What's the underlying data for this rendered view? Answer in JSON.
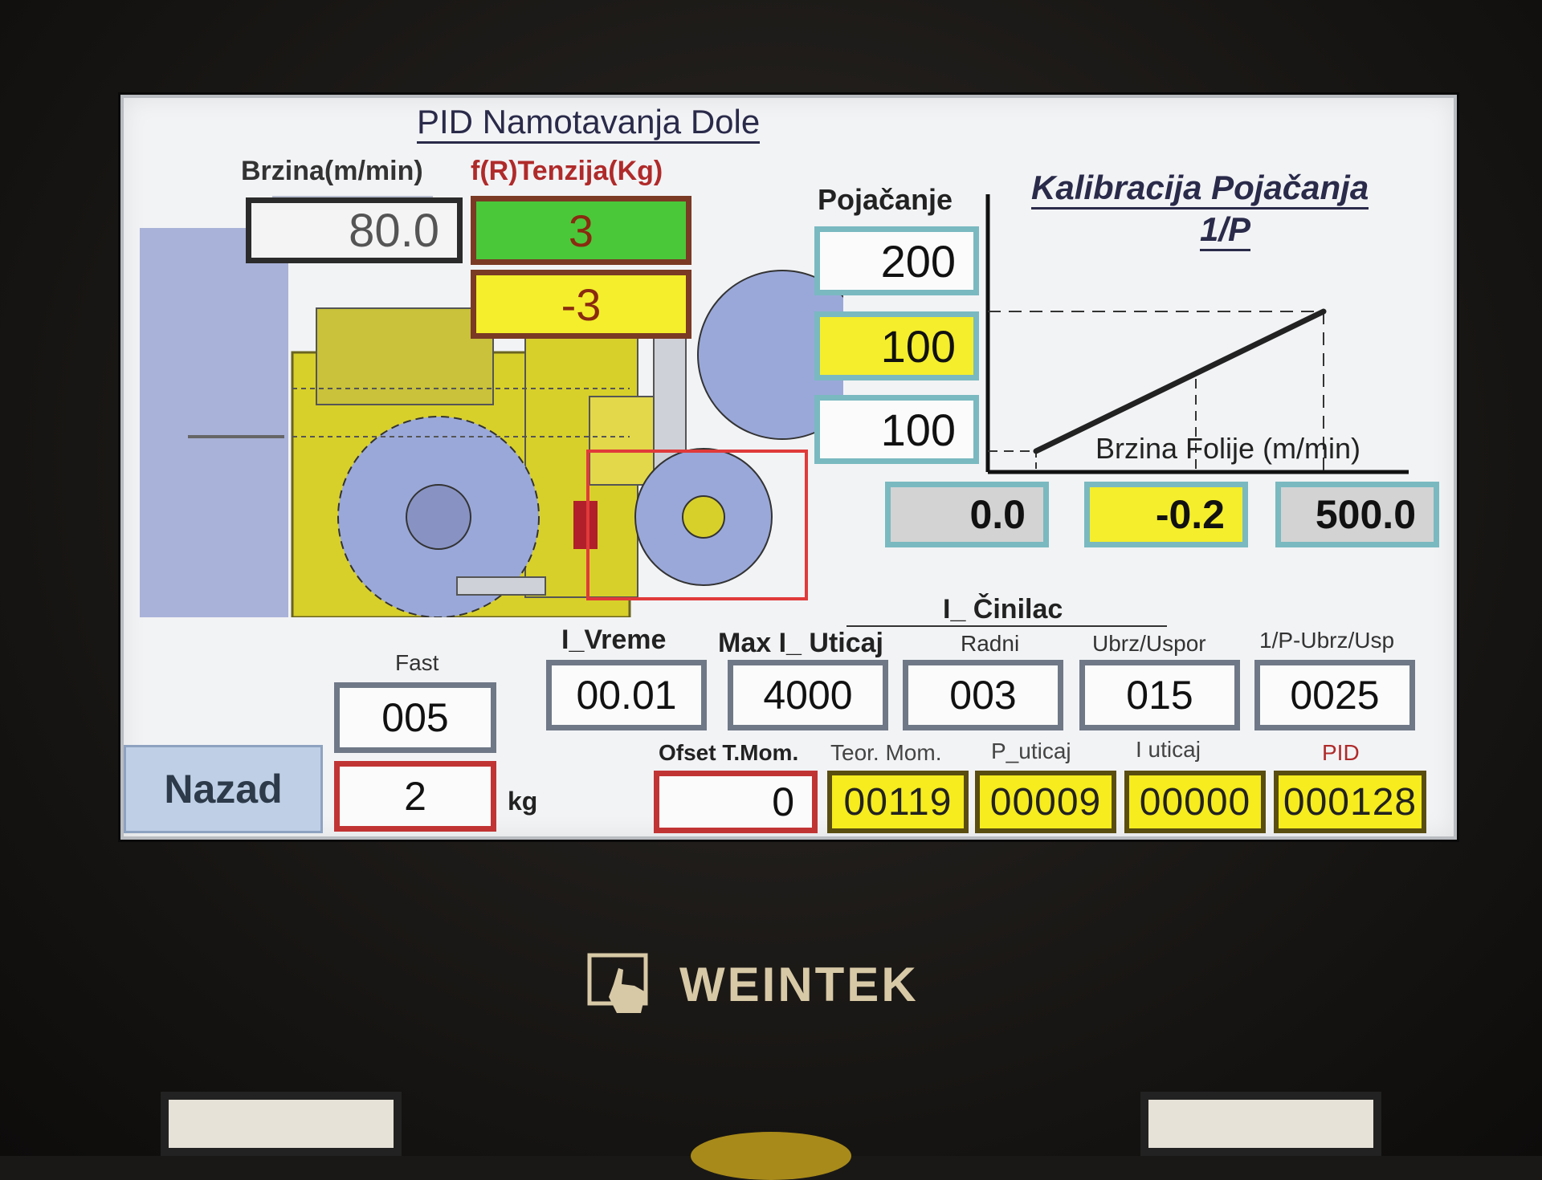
{
  "title": "PID Namotavanja Dole",
  "speed": {
    "label": "Brzina(m/min)",
    "value": "80.0"
  },
  "tension": {
    "label": "f(R)Tenzija(Kg)",
    "value": "3",
    "offset_value": "-3"
  },
  "gain": {
    "label": "Pojačanje",
    "values": [
      "200",
      "100",
      "100"
    ]
  },
  "calibration": {
    "title": "Kalibracija Pojačanja",
    "subtitle": "1/P",
    "xlabel": "Brzina Folije (m/min)",
    "x_values": [
      "0.0",
      "-0.2",
      "500.0"
    ]
  },
  "fast": {
    "label": "Fast",
    "value": "005"
  },
  "nazad_label": "Nazad",
  "weight": {
    "value": "2",
    "unit": "kg"
  },
  "params": {
    "i_vreme": {
      "label": "I_Vreme",
      "value": "00.01"
    },
    "max_i_uticaj": {
      "label": "Max I_ Uticaj",
      "value": "4000"
    },
    "cinilac_title": "I_ Činilac",
    "radni": {
      "label": "Radni",
      "value": "003"
    },
    "ubrz_uspor": {
      "label": "Ubrz/Uspor",
      "value": "015"
    },
    "p_ubrz_usp": {
      "label": "1/P-Ubrz/Usp",
      "value": "0025"
    }
  },
  "bottom": {
    "ofset": {
      "label": "Ofset T.Mom.",
      "value": "0"
    },
    "teor": {
      "label": "Teor. Mom.",
      "value": "00119"
    },
    "p_uticaj": {
      "label": "P_uticaj",
      "value": "00009"
    },
    "i_uticaj": {
      "label": "I uticaj",
      "value": "00000"
    },
    "pid": {
      "label": "PID",
      "value": "000128"
    }
  },
  "brand": "WEINTEK",
  "colors": {
    "yellow": "#f4ee2c",
    "green": "#4ac83a",
    "teal_border": "#7ab9c0",
    "red_border": "#c13434",
    "machine_yellow": "#d8d02a",
    "machine_blue": "#a9b2d8"
  }
}
